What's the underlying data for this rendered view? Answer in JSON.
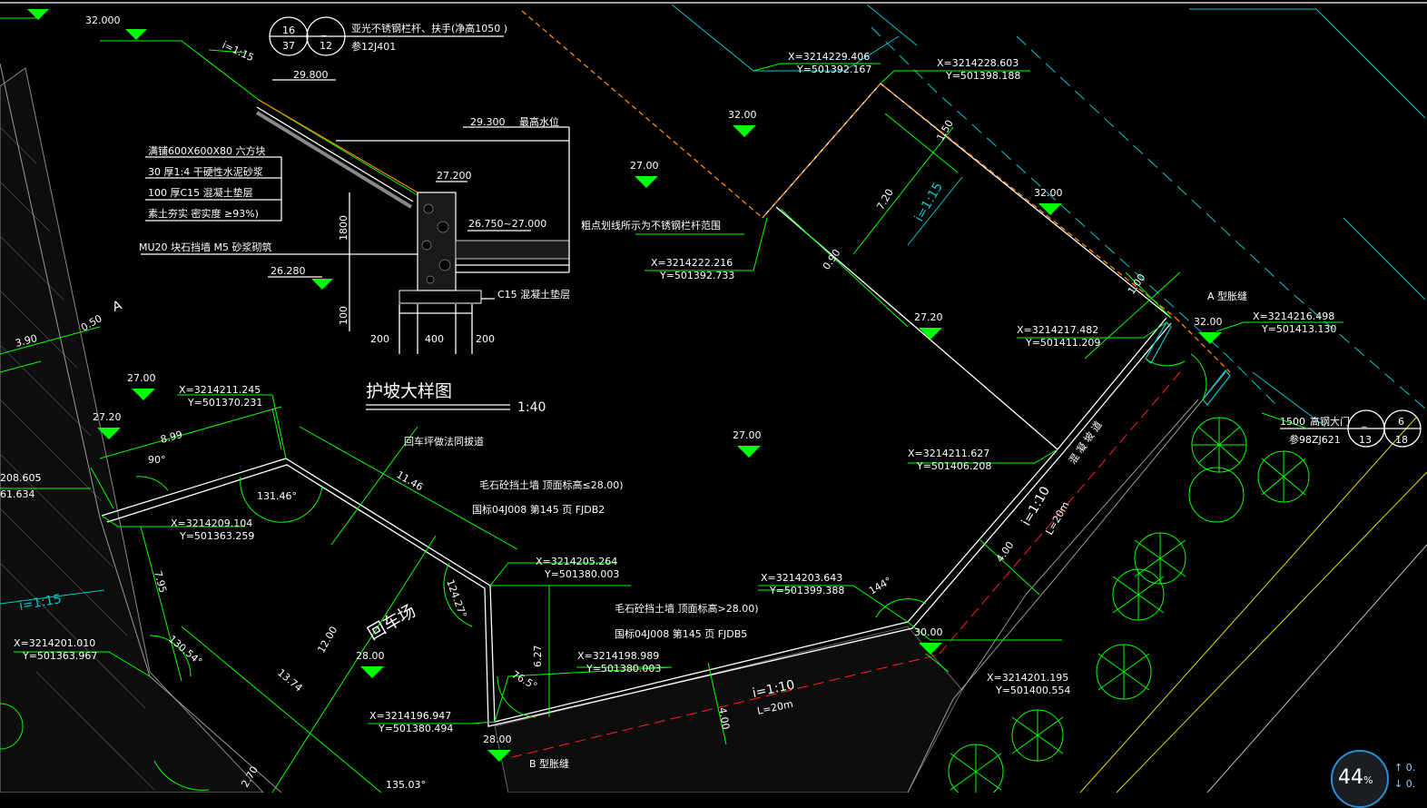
{
  "section": {
    "elev_top": "32.000",
    "slope_top": "i=1:15",
    "elev_mid": "29.800",
    "elev_water": "29.300",
    "water_label": "最高水位",
    "elev_wall_top": "27.200",
    "elev_fill": "26.750~27.000",
    "elev_bottom": "26.280",
    "dim_height": "1800",
    "dim_base": "100",
    "dim_w1": "200",
    "dim_w2": "400",
    "dim_w3": "200",
    "layers": [
      "满铺600X600X80     六方块",
      "30  厚1:4  干硬性水泥砂浆",
      "100  厚C15  混凝土垫层",
      "素土夯实 密实度 ≥93%)"
    ],
    "wall_note": "MU20   块石挡墙  M5  砂浆砌筑",
    "pad_note": "C15  混凝土垫层",
    "title": "护坡大样图",
    "scale": "1:40"
  },
  "ref_box": {
    "r1c1": "16",
    "r1c2": "_",
    "r2c1": "37",
    "r2c2": "12",
    "note1": "亚光不锈钢栏杆、扶手(净高1050  )",
    "note2": "参12J401"
  },
  "gate": {
    "width": "1500",
    "label": "高钢大门",
    "r1c1": "_",
    "r1c2": "6",
    "r2c1": "13",
    "r2c2": "18",
    "ref": "参98ZJ621"
  },
  "coords": [
    {
      "x": "X=3214229.406",
      "y": "Y=501392.167"
    },
    {
      "x": "X=3214228.603",
      "y": "Y=501398.188"
    },
    {
      "x": "X=3214222.216",
      "y": "Y=501392.733"
    },
    {
      "x": "X=3214216.498",
      "y": "Y=501413.130"
    },
    {
      "x": "X=3214217.482",
      "y": "Y=501411.209"
    },
    {
      "x": "X=3214211.245",
      "y": "Y=501370.231"
    },
    {
      "x": "X=3214211.627",
      "y": "Y=501406.208"
    },
    {
      "x": "X=3214209.104",
      "y": "Y=501363.259"
    },
    {
      "x": "X=3214205.264",
      "y": "Y=501380.003"
    },
    {
      "x": "X=3214203.643",
      "y": "Y=501399.388"
    },
    {
      "x": "X=3214198.989",
      "y": "Y=501380.003"
    },
    {
      "x": "X=3214201.010",
      "y": "Y=501363.967"
    },
    {
      "x": "X=3214201.195",
      "y": "Y=501400.554"
    },
    {
      "x": "X=3214196.947",
      "y": "Y=501380.494"
    },
    {
      "x": "",
      "y": ""
    }
  ],
  "left_edge": {
    "a": "208.605",
    "b": "61.634"
  },
  "elevations": [
    "27.00",
    "32.00",
    "32.00",
    "27.20",
    "32.00",
    "27.00",
    "27.00",
    "27.20",
    "28.00",
    "30.00",
    "28.00"
  ],
  "dims": {
    "d_150": "1.50",
    "d_720": "7.20",
    "d_i115": "i=1:15",
    "d_090": "0.90",
    "d_100": "1.00",
    "d_899": "8.99",
    "d_1146": "11.46",
    "d_795": "7.95",
    "d_1200": "12.00",
    "d_1374": "13.74",
    "d_627": "6.27",
    "d_400": "4.00",
    "d_400b": "4.00",
    "d_390": "3.90",
    "d_050": "0.50",
    "d_270": "2.70",
    "ang_90": "90°",
    "ang_13146": "131.46°",
    "ang_12427": "124.27°",
    "ang_765": "76.5°",
    "ang_144": "144°",
    "ang_13054": "130.54°",
    "ang_13503": "135.03°",
    "slope1": "i=1:10",
    "len1": "L=20m",
    "slope2": "i=1:10",
    "len2": "L=20m",
    "slope_left": "i=1:15"
  },
  "notes": {
    "railing": "粗点划线所示为不锈钢栏杆范围",
    "joint_a": "A 型胀缝",
    "joint_b": "B 型胀缝",
    "turn_note": "回车坪做法同拔道",
    "wall1": "毛石砼挡土墙 顶面标高≤28.00)",
    "wall1_ref": "国标04J008       第145  页  FJDB2",
    "wall2": "毛石砼挡土墙 顶面标高>28.00)",
    "wall2_ref": "国标04J008       第145  页  FJDB5",
    "turnaround": "回车场",
    "ramp": "混 凝 坡 道",
    "section_mark": "A"
  },
  "hud": {
    "percent": "44",
    "unit": "%",
    "up": "↑ 0.",
    "down": "↓ 0."
  },
  "colors": {
    "background": "#000000",
    "green": "#00ff00",
    "white": "#ffffff",
    "cyan": "#00c8d0",
    "red": "#ff2020",
    "orange": "#ff8a00",
    "yellow": "#e0e000",
    "gray": "#9a9a9a"
  }
}
